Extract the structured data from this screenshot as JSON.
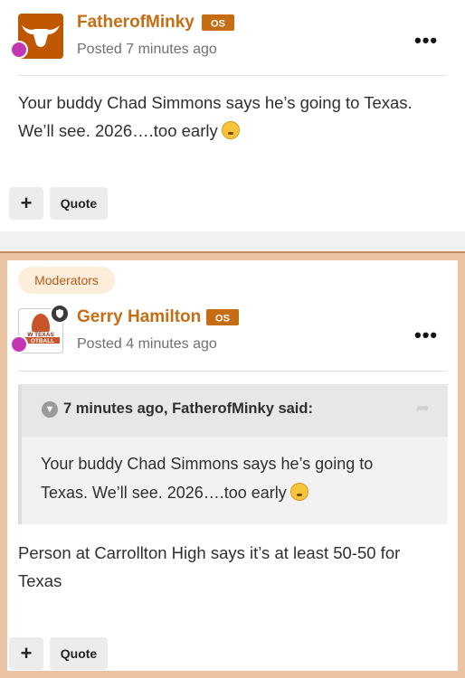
{
  "post1": {
    "author": "FatherofMinky",
    "posted": "Posted 7 minutes ago",
    "body_line1": "Your buddy Chad Simmons says he’s going to Texas.",
    "body_line2": "We’ll see. 2026….too early",
    "plus": "+",
    "quote": "Quote"
  },
  "post2": {
    "group_badge": "Moderators",
    "author": "Gerry Hamilton",
    "posted": "Posted 4 minutes ago",
    "avatar_text_1": "W TEXAS",
    "avatar_text_2": "OTBALL",
    "quote_header": "7 minutes ago, FatherofMinky said:",
    "quote_line1": "Your buddy Chad Simmons says he’s going to",
    "quote_line2": "Texas. We’ll see. 2026….too early",
    "body_line1": "Person at Carrollton High says it’s at least 50-50 for",
    "body_line2": "Texas",
    "plus": "+",
    "quote": "Quote"
  },
  "flair_text": "OS",
  "colors": {
    "accent": "#c66d14",
    "moderator_border": "#ecc3a3",
    "badge": "#c436b4"
  },
  "icons": [
    "longhorn-avatar-icon",
    "share-badge-icon",
    "moderator-shield-icon",
    "more-options-icon",
    "chevron-down-icon",
    "share-arrow-icon",
    "emoji-icon"
  ]
}
